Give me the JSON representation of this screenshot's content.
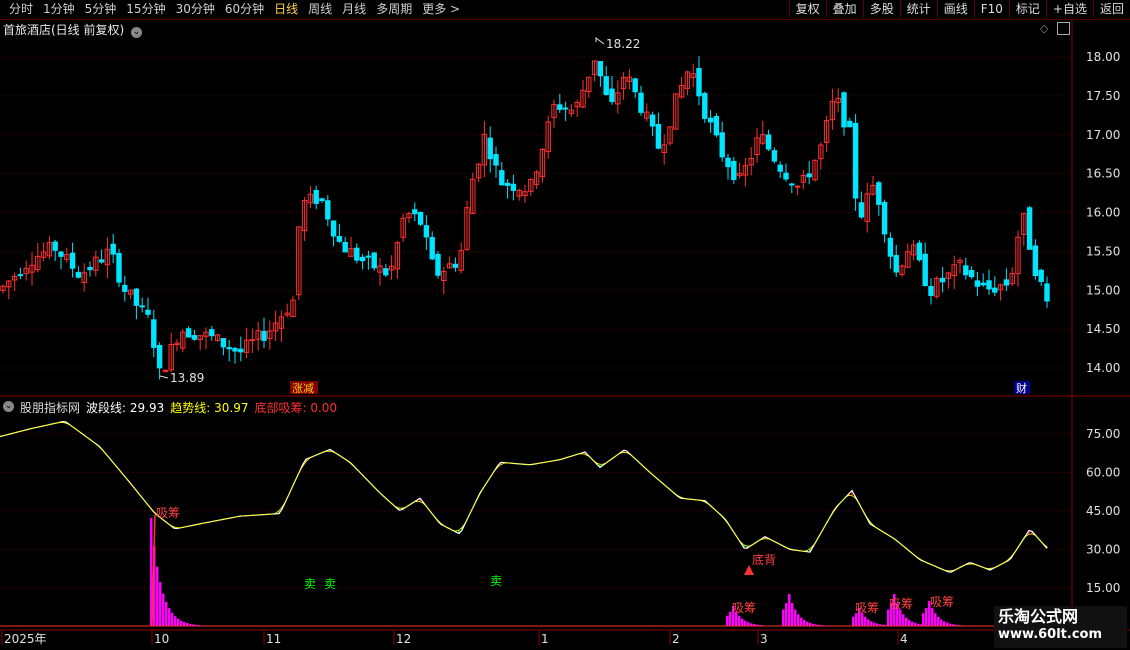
{
  "toolbar": {
    "periods": [
      "分时",
      "1分钟",
      "5分钟",
      "15分钟",
      "30分钟",
      "60分钟",
      "日线",
      "周线",
      "月线",
      "多周期",
      "更多 >"
    ],
    "active": "日线",
    "actions": [
      "复权",
      "叠加",
      "多股",
      "统计",
      "画线",
      "F10",
      "标记",
      "+自选",
      "返回"
    ]
  },
  "main_panel": {
    "title": "首旅酒店(日线 前复权)",
    "y_ticks": [
      "18.00",
      "17.50",
      "17.00",
      "16.50",
      "16.00",
      "15.50",
      "15.00",
      "14.50",
      "14.00"
    ],
    "high_label": "18.22",
    "low_label": "13.89",
    "badge_left": "涨减",
    "badge_right": "财"
  },
  "indicator_panel": {
    "name": "股朋指标网",
    "wave_label": "波段线:",
    "wave_value": "29.93",
    "trend_label": "趋势线:",
    "trend_value": "30.97",
    "bottom_label": "底部吸筹:",
    "bottom_value": "0.00",
    "y_ticks": [
      "75.00",
      "60.00",
      "45.00",
      "30.00",
      "15.00"
    ],
    "annotations": [
      "吸筹",
      "卖",
      "卖",
      "卖",
      "底背",
      "吸筹",
      "吸筹",
      "吸筹",
      "吸筹"
    ]
  },
  "x_axis": [
    "2025年",
    "10",
    "11",
    "12",
    "1",
    "2",
    "3",
    "4"
  ],
  "watermark": {
    "line1": "乐淘公式网",
    "line2": "www.60lt.com"
  },
  "colors": {
    "up": "#ff3030",
    "down": "#00e5ff",
    "green": "#00ff00",
    "magenta": "#ff00ff",
    "axis": "#8b0000"
  }
}
